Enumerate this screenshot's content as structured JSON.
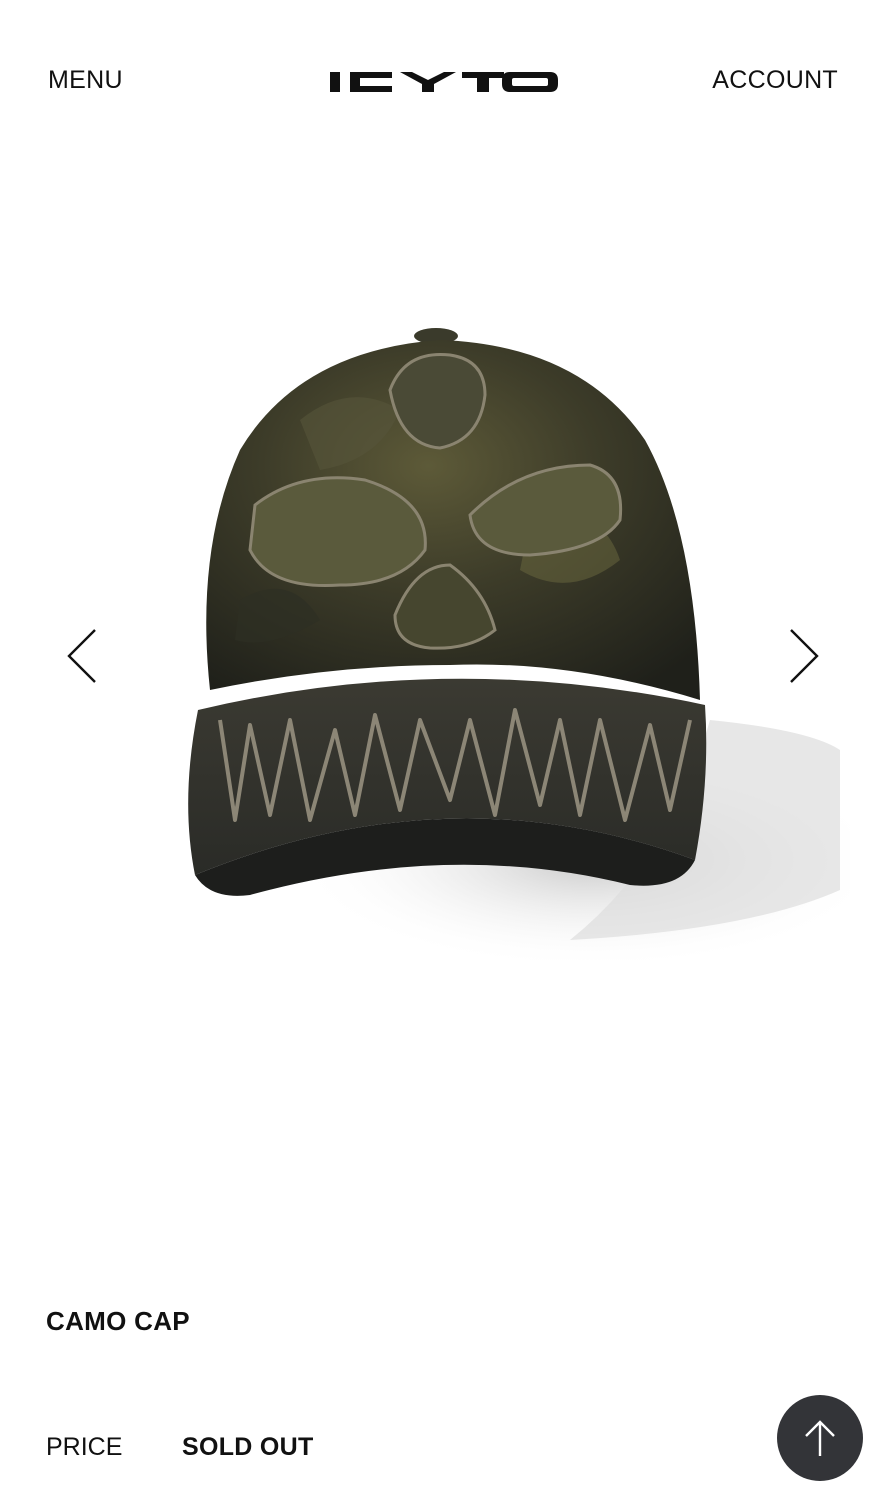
{
  "header": {
    "menu_label": "MENU",
    "brand": "ICYTO",
    "account_label": "ACCOUNT"
  },
  "gallery": {
    "prev_icon": "chevron-left-icon",
    "next_icon": "chevron-right-icon",
    "image_subject": "camo baseball cap with frayed skull patches"
  },
  "product": {
    "title": "CAMO CAP",
    "price_label": "PRICE",
    "price_value": "SOLD OUT"
  },
  "scroll_top": {
    "icon": "arrow-up-icon",
    "background": "#333438"
  },
  "colors": {
    "text": "#111111",
    "background": "#ffffff"
  }
}
